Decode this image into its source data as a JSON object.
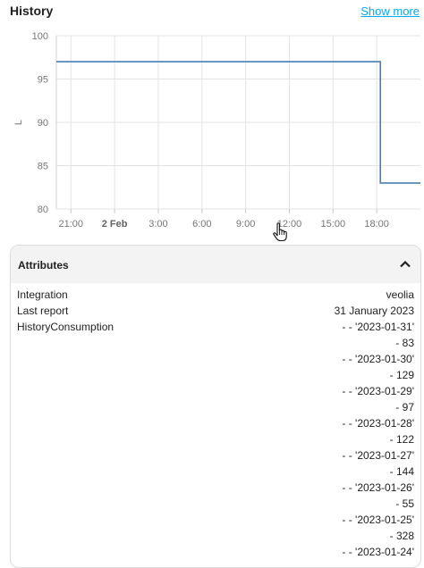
{
  "header": {
    "title": "History",
    "show_more": "Show more"
  },
  "chart_data": {
    "type": "line",
    "title": "",
    "xlabel": "",
    "ylabel": "L",
    "ylim": [
      80,
      100
    ],
    "y_ticks": [
      "100",
      "95",
      "90",
      "85",
      "80"
    ],
    "x_ticks": [
      "21:00",
      "2 Feb",
      "3:00",
      "6:00",
      "9:00",
      "12:00",
      "15:00",
      "18:00"
    ],
    "grid": true,
    "series": [
      {
        "color": "#4a7fb5",
        "points": [
          {
            "x": "2023-02-01 20:00",
            "y": 97
          },
          {
            "x": "2023-02-02 18:15",
            "y": 97
          },
          {
            "x": "2023-02-02 18:15",
            "y": 83
          },
          {
            "x": "2023-02-02 21:00",
            "y": 83
          }
        ]
      }
    ]
  },
  "attributes": {
    "title": "Attributes",
    "rows": [
      {
        "name": "Integration",
        "value": "veolia"
      },
      {
        "name": "Last report",
        "value": "31 January 2023"
      }
    ],
    "history_name": "HistoryConsumption",
    "history_lines": [
      "- - '2023-01-31'",
      "- 83",
      "- - '2023-01-30'",
      "- 129",
      "- - '2023-01-29'",
      "- 97",
      "- - '2023-01-28'",
      "- 122",
      "- - '2023-01-27'",
      "- 144",
      "- - '2023-01-26'",
      "- 55",
      "- - '2023-01-25'",
      "- 328",
      "- - '2023-01-24'"
    ]
  }
}
